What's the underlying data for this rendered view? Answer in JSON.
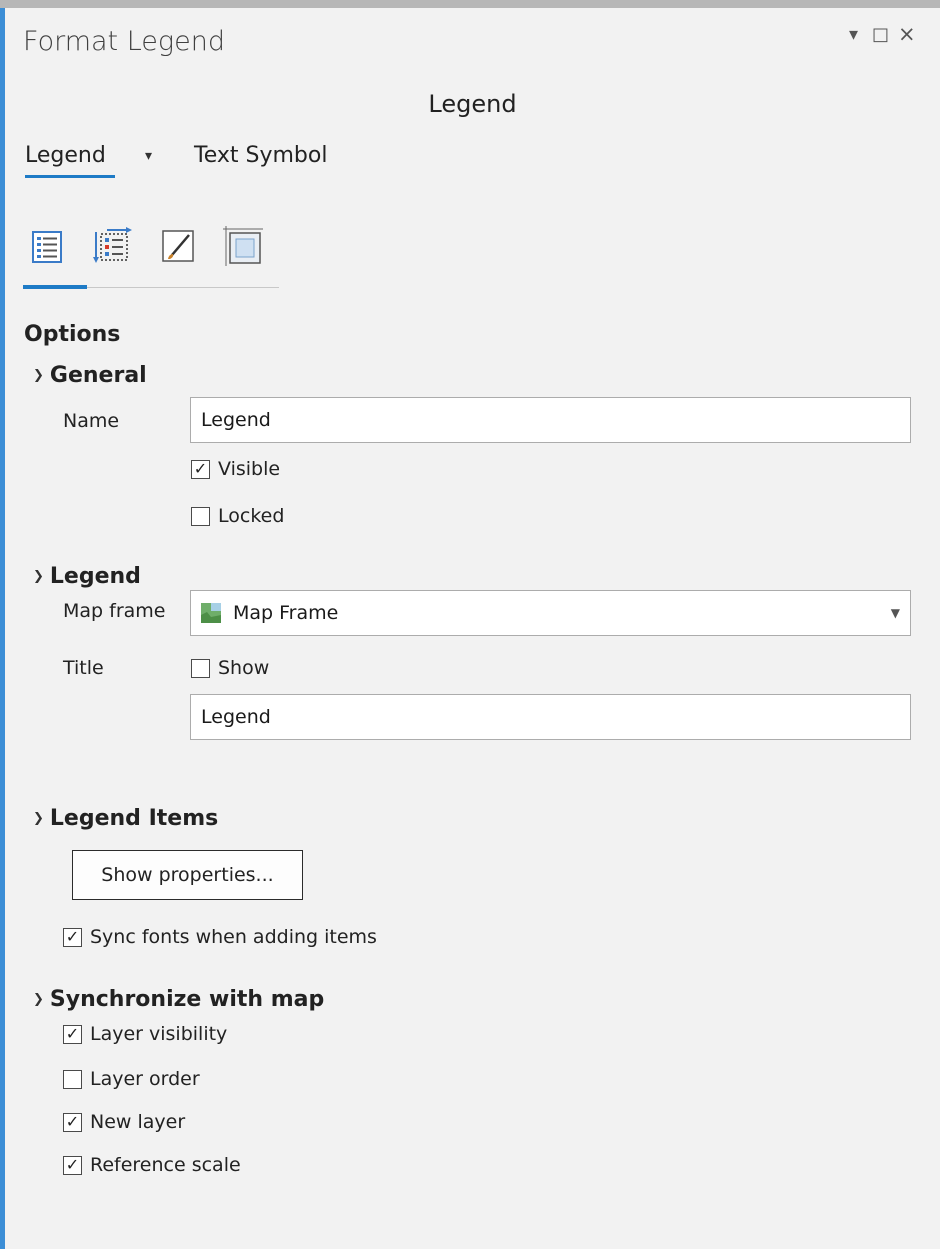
{
  "window": {
    "title": "Format Legend",
    "controls": [
      "▾",
      "□",
      "×"
    ]
  },
  "heading": "Legend",
  "tabs": [
    {
      "label": "Legend",
      "active": true
    },
    {
      "label": "Text Symbol",
      "active": false
    }
  ],
  "tab_dropdown_icon": "▾",
  "toolbar_icons": [
    "legend-options-icon",
    "legend-arrangement-icon",
    "symbol-brush-icon",
    "display-frame-icon"
  ],
  "options_title": "Options",
  "general": {
    "header": "General",
    "name_label": "Name",
    "name_value": "Legend",
    "visible_label": "Visible",
    "visible_checked": true,
    "locked_label": "Locked",
    "locked_checked": false
  },
  "legend": {
    "header": "Legend",
    "map_frame_label": "Map frame",
    "map_frame_value": "Map Frame",
    "title_label": "Title",
    "show_label": "Show",
    "show_checked": false,
    "title_value": "Legend"
  },
  "legend_items": {
    "header": "Legend Items",
    "show_properties": "Show properties...",
    "sync_fonts_label": "Sync fonts when adding items",
    "sync_fonts_checked": true
  },
  "sync_map": {
    "header": "Synchronize with map",
    "items": [
      {
        "label": "Layer visibility",
        "checked": true
      },
      {
        "label": "Layer order",
        "checked": false
      },
      {
        "label": "New layer",
        "checked": true
      },
      {
        "label": "Reference scale",
        "checked": true
      }
    ]
  },
  "colors": {
    "accent": "#1e7bc6",
    "left_border": "#3c8ed6",
    "panel_bg": "#f2f2f2"
  }
}
